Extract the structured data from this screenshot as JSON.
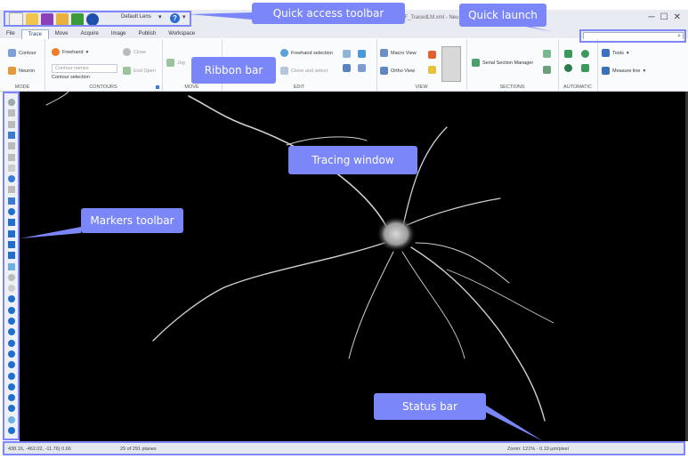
{
  "quick_access": {
    "lens": "Default Lens",
    "more": "▾",
    "help": "?"
  },
  "window": {
    "title": "DF_TracedLM.xml - Neu",
    "buttons": [
      "─",
      "☐",
      "✕"
    ]
  },
  "tabs": [
    "File",
    "Trace",
    "Move",
    "Acquire",
    "Image",
    "Publish",
    "Workspace"
  ],
  "active_tab": "Trace",
  "search": {
    "placeholder": "",
    "icon": "search-icon"
  },
  "ribbon": {
    "mode": {
      "label": "MODE",
      "contour": "Contour",
      "neuron": "Neuron"
    },
    "contours": {
      "label": "CONTOURS",
      "freehand": "Freehand",
      "contour_names": "Contour names",
      "contour_selection": "Contour selection",
      "close": "Close",
      "end_open": "End Open"
    },
    "move": {
      "label": "MOVE",
      "jog": "Jog"
    },
    "edit": {
      "label": "EDIT",
      "freehand_selection": "Freehand selection",
      "clone_and_select": "Clone and select"
    },
    "view": {
      "label": "VIEW",
      "macro_view": "Macro View",
      "ortho_view": "Ortho View"
    },
    "sections": {
      "label": "SECTIONS",
      "serial_section_manager": "Serial Section Manager"
    },
    "automatic": {
      "label": "AUTOMATIC"
    },
    "tools": {
      "tools": "Tools",
      "measure_line": "Measure line"
    }
  },
  "status": {
    "coords": "438.16, -462.02, -11.76) 0.66",
    "planes": "29 of 291 planes",
    "zoom": "Zoom: 121% - 0.19 µm/pixel"
  },
  "callouts": {
    "quick_access": "Quick access toolbar",
    "quick_launch": "Quick launch",
    "ribbon": "Ribbon bar",
    "tracing": "Tracing window",
    "markers": "Markers toolbar",
    "status": "Status bar"
  },
  "colors": {
    "callout": "#7b86f9",
    "outline": "#7f86ff",
    "accent": "#1a3f7a"
  }
}
